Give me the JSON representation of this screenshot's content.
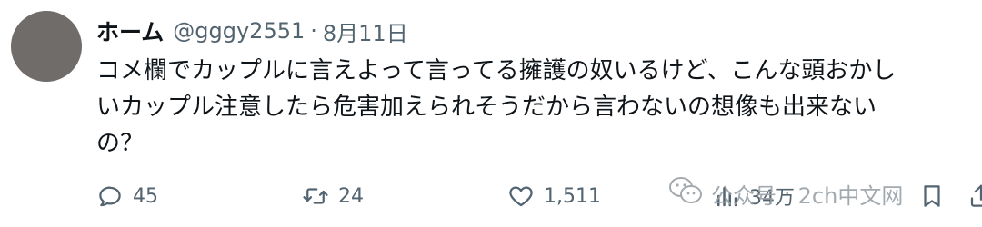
{
  "tweet": {
    "author": {
      "display_name": "ホーム",
      "handle": "@gggy2551",
      "separator": "·",
      "date": "8月11日"
    },
    "text_lines": [
      "コメ欄でカップルに言えよって言ってる擁護の奴いるけど、こんな頭おかし",
      "いカップル注意したら危害加えられそうだから言わないの想像も出来ない",
      "の？"
    ],
    "actions": {
      "reply": {
        "icon": "reply-icon",
        "count": "45"
      },
      "retweet": {
        "icon": "retweet-icon",
        "count": "24"
      },
      "like": {
        "icon": "heart-icon",
        "count": "1,511"
      },
      "views": {
        "icon": "views-icon",
        "count": "34万"
      },
      "bookmark": {
        "icon": "bookmark-icon"
      },
      "share": {
        "icon": "share-icon"
      }
    }
  },
  "watermark": {
    "left": "公众号",
    "separator": "·",
    "right": "2ch中文网"
  },
  "colors": {
    "text": "#0f1419",
    "secondary": "#536471",
    "avatar": "#6f6c69",
    "watermark": "#9aa1a7"
  }
}
